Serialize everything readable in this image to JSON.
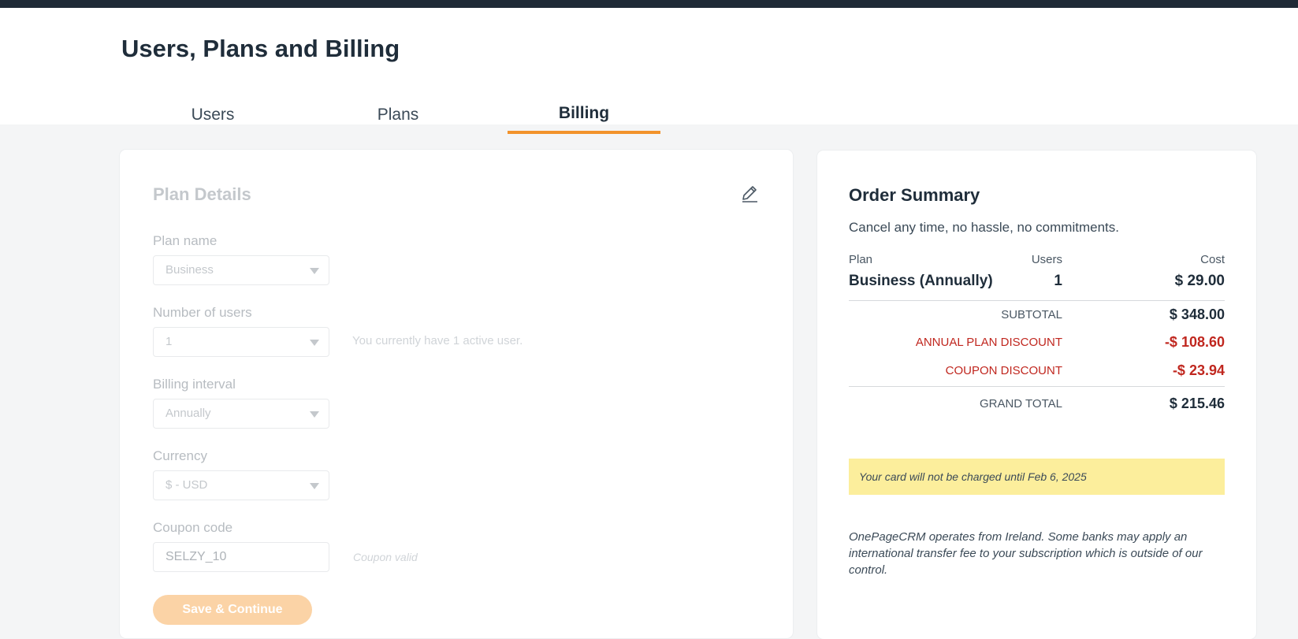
{
  "header": {
    "title": "Users, Plans and Billing",
    "tabs": [
      {
        "label": "Users"
      },
      {
        "label": "Plans"
      },
      {
        "label": "Billing"
      }
    ],
    "active_tab": "Billing",
    "accent_color": "#f2932b"
  },
  "plan_details": {
    "title": "Plan Details",
    "edit_icon": "pencil-icon",
    "plan_name": {
      "label": "Plan name",
      "value": "Business"
    },
    "number_of_users": {
      "label": "Number of users",
      "value": "1",
      "hint": "You currently have 1 active user."
    },
    "billing_interval": {
      "label": "Billing interval",
      "value": "Annually"
    },
    "currency": {
      "label": "Currency",
      "value": "$ - USD"
    },
    "coupon": {
      "label": "Coupon code",
      "value": "SELZY_10",
      "hint": "Coupon valid"
    },
    "save_label": "Save & Continue"
  },
  "order_summary": {
    "title": "Order Summary",
    "subtitle": "Cancel any time, no hassle, no commitments.",
    "columns": {
      "plan": "Plan",
      "users": "Users",
      "cost": "Cost"
    },
    "row": {
      "plan": "Business (Annually)",
      "users": "1",
      "cost": "$ 29.00"
    },
    "subtotal": {
      "label": "SUBTOTAL",
      "value": "$ 348.00"
    },
    "annual_discount": {
      "label": "ANNUAL PLAN DISCOUNT",
      "value": "-$ 108.60"
    },
    "coupon_discount": {
      "label": "COUPON DISCOUNT",
      "value": "-$ 23.94"
    },
    "grand_total": {
      "label": "GRAND TOTAL",
      "value": "$ 215.46"
    },
    "notice": "Your card will not be charged until Feb 6, 2025",
    "footnote": "OnePageCRM operates from Ireland. Some banks may apply an international transfer fee to your subscription which is outside of our control.",
    "discount_color": "#c0271f",
    "notice_color": "#fcee9c"
  }
}
